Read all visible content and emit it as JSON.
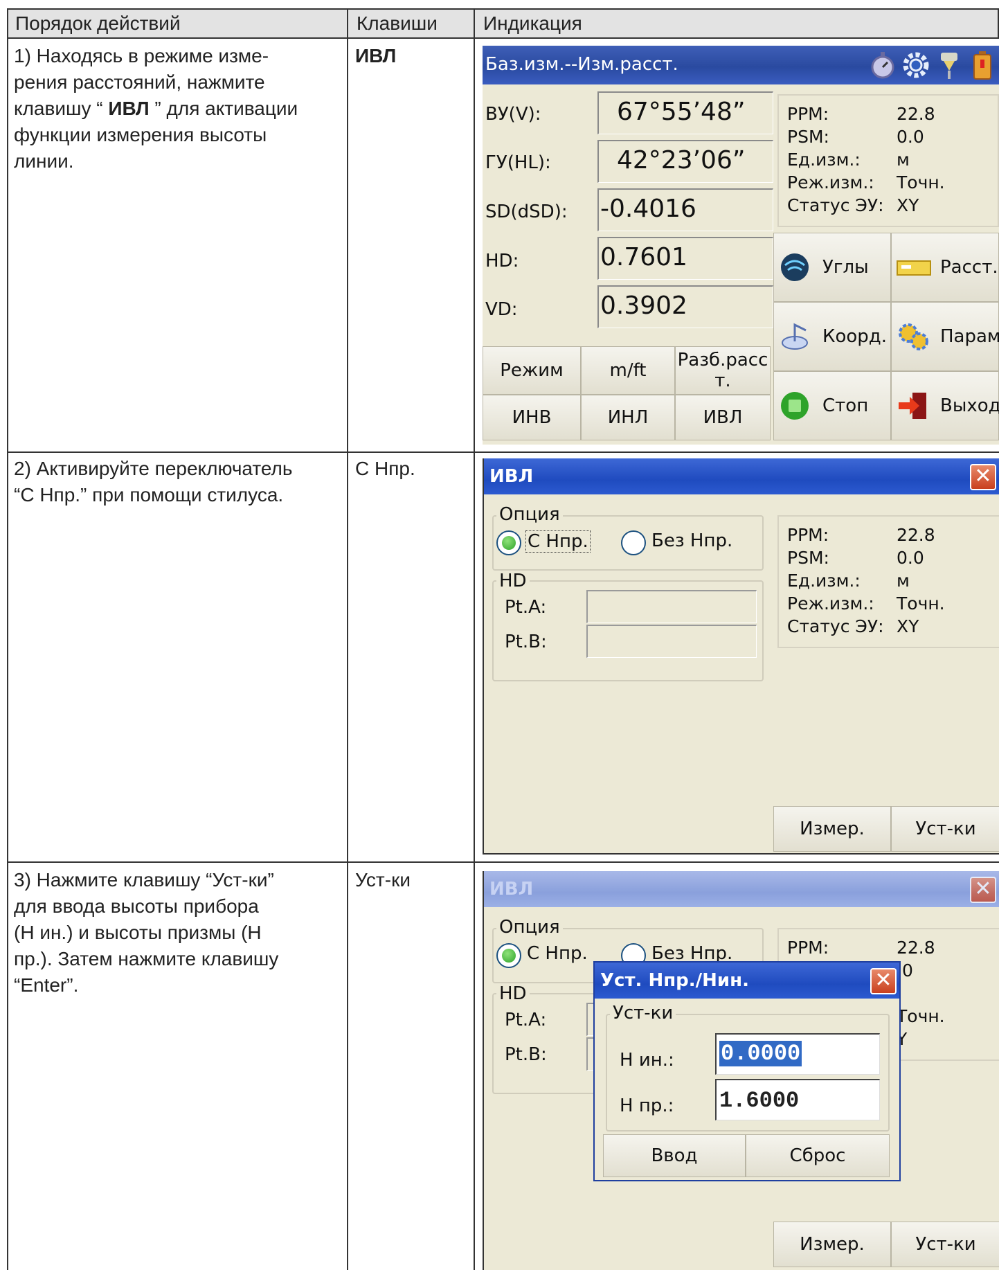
{
  "table": {
    "headers": [
      "Порядок действий",
      "Клавиши",
      "Индикация"
    ]
  },
  "steps": [
    {
      "text_parts": [
        "1) Находясь в режиме изме-",
        "рения расстояний, нажмите",
        "клавишу “ ",
        "ИВЛ",
        " ” для активации",
        "функции измерения высоты",
        "линии."
      ],
      "key": "ИВЛ"
    },
    {
      "text_lines": [
        "2) Активируйте переключатель",
        "“С Нпр.” при помощи стилуса."
      ],
      "key": "С Нпр."
    },
    {
      "text_lines": [
        "3) Нажмите клавишу “Уст-ки”",
        "для ввода высоты прибора",
        "(Н ин.) и высоты призмы (Н",
        "пр.). Затем нажмите клавишу",
        "“Enter”."
      ],
      "key": "Уст-ки"
    }
  ],
  "screen1": {
    "title": "Баз.изм.--Изм.расст.",
    "icons": [
      "stopwatch-icon",
      "gear-icon",
      "prism-icon",
      "battery-icon"
    ],
    "measurements": [
      {
        "label": "ВУ(V):",
        "value": "67°55’48”"
      },
      {
        "label": "ГУ(HL):",
        "value": "42°23’06”"
      },
      {
        "label": "SD(dSD):",
        "value": "-0.4016"
      },
      {
        "label": "HD:",
        "value": "0.7601"
      },
      {
        "label": "VD:",
        "value": "0.3902"
      }
    ],
    "status": [
      {
        "k": "PPM:",
        "v": "22.8"
      },
      {
        "k": "PSM:",
        "v": "0.0"
      },
      {
        "k": "Ед.изм.:",
        "v": "м"
      },
      {
        "k": "Реж.изм.:",
        "v": "Точн."
      },
      {
        "k": "Статус ЭУ:",
        "v": "XY"
      }
    ],
    "softkeys_row1": [
      "Режим",
      "m/ft",
      "Разб.расс т."
    ],
    "softkeys_row2": [
      "ИНВ",
      "ИНЛ",
      "ИВЛ"
    ],
    "menu": [
      {
        "label": "Углы",
        "icon": "globe-icon"
      },
      {
        "label": "Расст.",
        "icon": "ruler-icon"
      },
      {
        "label": "Коорд.",
        "icon": "coordinates-icon"
      },
      {
        "label": "Парам.",
        "icon": "settings-icon"
      },
      {
        "label": "Стоп",
        "icon": "stop-icon"
      },
      {
        "label": "Выход",
        "icon": "exit-icon"
      }
    ]
  },
  "screen2": {
    "title": "ИВЛ",
    "close": "✕",
    "option_group": "Опция",
    "radio_on": "С Нпр.",
    "radio_off": "Без Нпр.",
    "hd_group": "HD",
    "pt_a": "Pt.A:",
    "pt_b": "Pt.B:",
    "status": [
      {
        "k": "PPM:",
        "v": "22.8"
      },
      {
        "k": "PSM:",
        "v": "0.0"
      },
      {
        "k": "Ед.изм.:",
        "v": "м"
      },
      {
        "k": "Реж.изм.:",
        "v": "Точн."
      },
      {
        "k": "Статус ЭУ:",
        "v": "XY"
      }
    ],
    "btn_measure": "Измер.",
    "btn_settings": "Уст-ки"
  },
  "screen3": {
    "title": "ИВЛ",
    "close": "✕",
    "option_group": "Опция",
    "radio_on": "С Нпр.",
    "radio_off": "Без Нпр.",
    "hd_group": "HD",
    "pt_a": "Pt.A:",
    "pt_b": "Pt.B:",
    "status_visible": [
      {
        "k": "PPM:",
        "v": "22.8"
      },
      {
        "k": "",
        "v": ".0"
      },
      {
        "k": "",
        "v": "Точн."
      },
      {
        "k": "",
        "v": "Y"
      }
    ],
    "btn_measure": "Измер.",
    "btn_settings": "Уст-ки",
    "dialog": {
      "title": "Уст. Нпр./Нин.",
      "close": "✕",
      "group": "Уст-ки",
      "h_in_label": "Н ин.:",
      "h_in_value": "0.0000",
      "h_pr_label": "Н пр.:",
      "h_pr_value": "1.6000",
      "btn_enter": "Ввод",
      "btn_reset": "Сброс"
    }
  }
}
